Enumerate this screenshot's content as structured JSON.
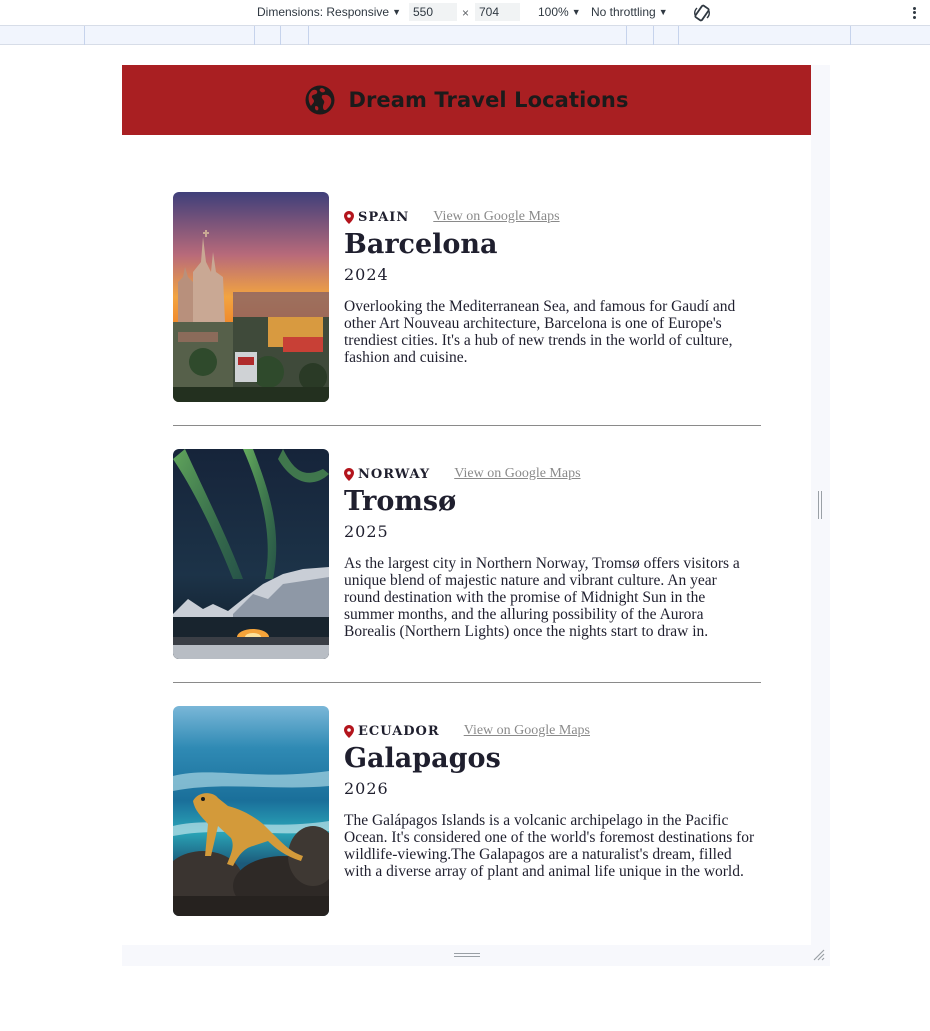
{
  "devtools": {
    "dimensions_label": "Dimensions: Responsive",
    "width_value": "550",
    "times_sign": "×",
    "height_value": "704",
    "zoom_label": "100%",
    "throttle_label": "No throttling"
  },
  "page": {
    "title": "Dream Travel Locations"
  },
  "locations": [
    {
      "country": "SPAIN",
      "maps_link": "View on Google Maps",
      "name": "Barcelona",
      "year": "2024",
      "description": "Overlooking the Mediterranean Sea, and famous for Gaudí and other Art Nouveau architecture, Barcelona is one of Europe's trendiest cities. It's a hub of new trends in the world of culture, fashion and cuisine."
    },
    {
      "country": "NORWAY",
      "maps_link": "View on Google Maps",
      "name": "Tromsø",
      "year": "2025",
      "description": "As the largest city in Northern Norway, Tromsø offers visitors a unique blend of majestic nature and vibrant culture. An year round destination with the promise of Midnight Sun in the summer months, and the alluring possibility of the Aurora Borealis (Northern Lights) once the nights start to draw in."
    },
    {
      "country": "ECUADOR",
      "maps_link": "View on Google Maps",
      "name": "Galapagos",
      "year": "2026",
      "description": "The Galápagos Islands is a volcanic archipelago in the Pacific Ocean. It's considered one of the world's foremost destinations for wildlife-viewing.The Galapagos are a naturalist's dream, filled with a diverse array of plant and animal life unique in the world."
    }
  ],
  "colors": {
    "header_bg": "#a91f22",
    "pin": "#b3141c",
    "link": "#8a8a8a",
    "text": "#1f1f2e"
  }
}
